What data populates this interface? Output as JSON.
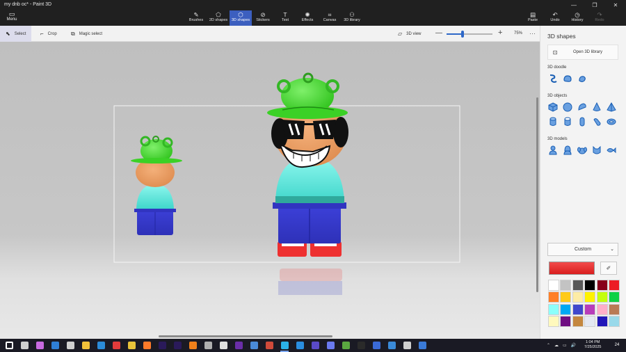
{
  "window": {
    "title": "my dnb oc* - Paint 3D",
    "minimize_glyph": "—",
    "maximize_glyph": "❐",
    "close_glyph": "✕"
  },
  "menu": {
    "label": "Menu",
    "icon": "folder-icon",
    "glyph": "▭"
  },
  "ribbon": {
    "tools": [
      {
        "label": "Brushes",
        "glyph": "✎",
        "icon": "brush-icon"
      },
      {
        "label": "2D shapes",
        "glyph": "⬠",
        "icon": "2d-shapes-icon"
      },
      {
        "label": "3D shapes",
        "glyph": "⬡",
        "icon": "3d-shapes-icon"
      },
      {
        "label": "Stickers",
        "glyph": "⊘",
        "icon": "sticker-icon"
      },
      {
        "label": "Text",
        "glyph": "T",
        "icon": "text-icon"
      },
      {
        "label": "Effects",
        "glyph": "✺",
        "icon": "effects-icon"
      },
      {
        "label": "Canvas",
        "glyph": "⌗",
        "icon": "canvas-icon"
      },
      {
        "label": "3D library",
        "glyph": "⚇",
        "icon": "3d-library-icon"
      }
    ],
    "active_tool": "3D shapes",
    "right_tools": [
      {
        "label": "Paste",
        "glyph": "▤",
        "icon": "paste-icon"
      },
      {
        "label": "Undo",
        "glyph": "↶",
        "icon": "undo-icon"
      },
      {
        "label": "History",
        "glyph": "◷",
        "icon": "history-icon"
      },
      {
        "label": "Redo",
        "glyph": "↷",
        "icon": "redo-icon"
      }
    ],
    "accent": "#3c5fbf"
  },
  "command_bar": {
    "select_label": "Select",
    "crop_label": "Crop",
    "magic_select_label": "Magic select",
    "view_3d_label": "3D view",
    "zoom_value": "75%",
    "zoom_fraction": 0.35,
    "select_glyph": "⬉",
    "crop_glyph": "⌐",
    "magic_glyph": "⧉",
    "view_glyph": "▱",
    "minus_glyph": "—",
    "plus_glyph": "+",
    "more_glyph": "···"
  },
  "panel": {
    "title": "3D shapes",
    "open_library_label": "Open 3D library",
    "library_glyph": "⊡",
    "doodle_heading": "3D doodle",
    "objects_heading": "3D objects",
    "models_heading": "3D models",
    "doodle_icons": [
      "sharp-edge-doodle-icon",
      "soft-edge-doodle-icon",
      "tube-doodle-icon"
    ],
    "object_icons": [
      "cube-icon",
      "sphere-icon",
      "hemisphere-icon",
      "cone-icon",
      "pyramid-icon",
      "cylinder-icon",
      "tube-icon",
      "capsule-icon",
      "donut-icon",
      "torus-icon"
    ],
    "model_icons": [
      "man-icon",
      "woman-icon",
      "dog-icon",
      "cat-icon",
      "fish-icon"
    ],
    "color_mode_label": "Custom",
    "chevron_glyph": "⌄",
    "eyedropper_glyph": "✐",
    "current_color": "#e8302f",
    "palette": [
      "#ffffff",
      "#c3c3c3",
      "#585858",
      "#000000",
      "#88001b",
      "#ec1c24",
      "#ff7f27",
      "#ffca18",
      "#fdeca6",
      "#fff200",
      "#c4ff0e",
      "#0ed145",
      "#8cfffb",
      "#00a8f3",
      "#3f48cc",
      "#b83dba",
      "#ffaec8",
      "#b97a56",
      "#fff9bd",
      "#6f0e82",
      "#c4873f",
      "#e4e8f2",
      "#2116b8",
      "#99d9ea"
    ]
  },
  "taskbar": {
    "time": "1:04 PM",
    "date": "7/25/2025",
    "notification_count": "24",
    "tray_glyphs": [
      "⌃",
      "☁",
      "▭",
      "🔊"
    ],
    "icons": [
      "start-icon",
      "task-view-icon",
      "copilot-icon",
      "mail-icon",
      "calculator-icon",
      "file-explorer-icon",
      "edge-icon",
      "opera-icon",
      "chrome-icon",
      "firefox-icon",
      "animate-icon",
      "premiere-icon",
      "blender-icon",
      "app-icon",
      "roblox-icon",
      "app-icon-2",
      "paint-icon",
      "app-icon-3",
      "paint-3d-icon",
      "vscode-icon",
      "app-icon-4",
      "discord-icon",
      "minecraft-icon",
      "terminal-icon",
      "app-icon-5",
      "app-icon-6",
      "app-icon-7",
      "app-icon-8"
    ]
  }
}
